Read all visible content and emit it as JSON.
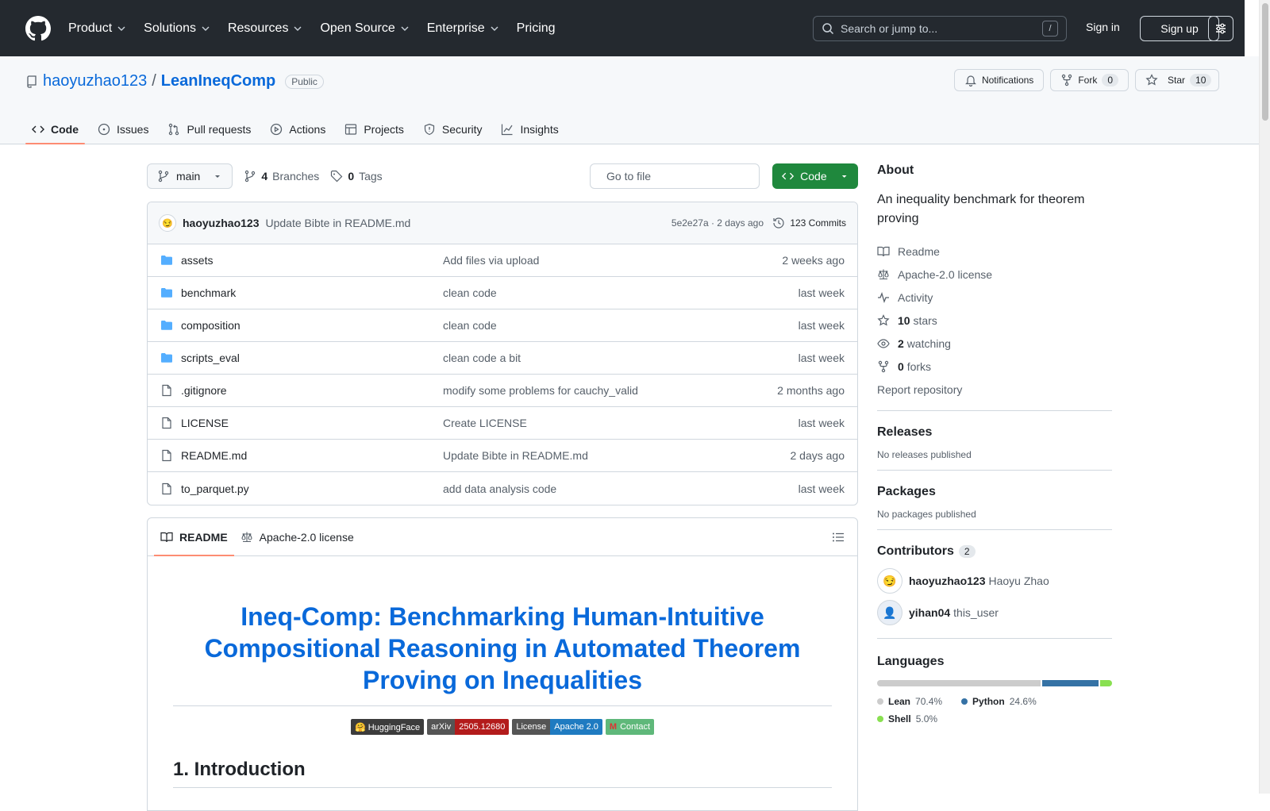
{
  "topnav": {
    "items": [
      {
        "label": "Product"
      },
      {
        "label": "Solutions"
      },
      {
        "label": "Resources"
      },
      {
        "label": "Open Source"
      },
      {
        "label": "Enterprise"
      },
      {
        "label": "Pricing"
      }
    ],
    "search_placeholder": "Search or jump to...",
    "search_key": "/",
    "signin": "Sign in",
    "signup": "Sign up"
  },
  "repo": {
    "owner": "haoyuzhao123",
    "separator": "/",
    "name": "LeanIneqComp",
    "visibility": "Public",
    "notifications_label": "Notifications",
    "fork_label": "Fork",
    "fork_count": "0",
    "star_label": "Star",
    "star_count": "10"
  },
  "tabs": [
    {
      "label": "Code",
      "icon": "code-icon"
    },
    {
      "label": "Issues",
      "icon": "issue-icon"
    },
    {
      "label": "Pull requests",
      "icon": "pull-request-icon"
    },
    {
      "label": "Actions",
      "icon": "play-icon"
    },
    {
      "label": "Projects",
      "icon": "table-icon"
    },
    {
      "label": "Security",
      "icon": "shield-icon"
    },
    {
      "label": "Insights",
      "icon": "graph-icon"
    }
  ],
  "branchbar": {
    "branch": "main",
    "branches_count": "4",
    "branches_label": "Branches",
    "tags_count": "0",
    "tags_label": "Tags",
    "goto_placeholder": "Go to file",
    "code_label": "Code"
  },
  "commit": {
    "author": "haoyuzhao123",
    "message": "Update Bibte in README.md",
    "meta": "5e2e27a · 2 days ago",
    "count_label": "123 Commits"
  },
  "files": [
    {
      "type": "folder",
      "name": "assets",
      "message": "Add files via upload",
      "date": "2 weeks ago"
    },
    {
      "type": "folder",
      "name": "benchmark",
      "message": "clean code",
      "date": "last week"
    },
    {
      "type": "folder",
      "name": "composition",
      "message": "clean code",
      "date": "last week"
    },
    {
      "type": "folder",
      "name": "scripts_eval",
      "message": "clean code a bit",
      "date": "last week"
    },
    {
      "type": "file",
      "name": ".gitignore",
      "message": "modify some problems for cauchy_valid",
      "date": "2 months ago"
    },
    {
      "type": "file",
      "name": "LICENSE",
      "message": "Create LICENSE",
      "date": "last week"
    },
    {
      "type": "file",
      "name": "README.md",
      "message": "Update Bibte in README.md",
      "date": "2 days ago"
    },
    {
      "type": "file",
      "name": "to_parquet.py",
      "message": "add data analysis code",
      "date": "last week"
    }
  ],
  "readme": {
    "tab_readme": "README",
    "tab_license": "Apache-2.0 license",
    "title": "Ineq-Comp: Benchmarking Human-Intuitive Compositional Reasoning in Automated Theorem Proving on Inequalities",
    "shields": [
      {
        "left": "🤗 HuggingFace",
        "right": "",
        "left_color": "#3c3c3c",
        "right_color": ""
      },
      {
        "left": "arXiv",
        "right": "2505.12680",
        "left_color": "#555555",
        "right_color": "#b31b1b"
      },
      {
        "left": "License",
        "right": "Apache 2.0",
        "left_color": "#555555",
        "right_color": "#1f7bc1"
      },
      {
        "left": "M",
        "right": "Contact",
        "left_color": "#5fb87a",
        "right_color": "#5fb87a"
      }
    ],
    "h2": "1. Introduction"
  },
  "about": {
    "heading": "About",
    "description": "An inequality benchmark for theorem proving",
    "links": [
      {
        "icon": "book-icon",
        "bold": "",
        "label": "Readme"
      },
      {
        "icon": "law-icon",
        "bold": "",
        "label": "Apache-2.0 license"
      },
      {
        "icon": "pulse-icon",
        "bold": "",
        "label": "Activity"
      },
      {
        "icon": "star-icon",
        "bold": "10",
        "label": "stars"
      },
      {
        "icon": "eye-icon",
        "bold": "2",
        "label": "watching"
      },
      {
        "icon": "fork-icon",
        "bold": "0",
        "label": "forks"
      }
    ],
    "report": "Report repository"
  },
  "releases": {
    "heading": "Releases",
    "text": "No releases published"
  },
  "packages": {
    "heading": "Packages",
    "text": "No packages published"
  },
  "contributors": {
    "heading": "Contributors",
    "count": "2",
    "people": [
      {
        "login": "haoyuzhao123",
        "name": "Haoyu Zhao"
      },
      {
        "login": "yihan04",
        "name": "this_user"
      }
    ]
  },
  "languages": {
    "heading": "Languages",
    "items": [
      {
        "name": "Lean",
        "pct": "70.4%",
        "value": 70.4,
        "color": "#cccccc"
      },
      {
        "name": "Python",
        "pct": "24.6%",
        "value": 24.6,
        "color": "#3572A5"
      },
      {
        "name": "Shell",
        "pct": "5.0%",
        "value": 5.0,
        "color": "#89e051"
      }
    ]
  }
}
